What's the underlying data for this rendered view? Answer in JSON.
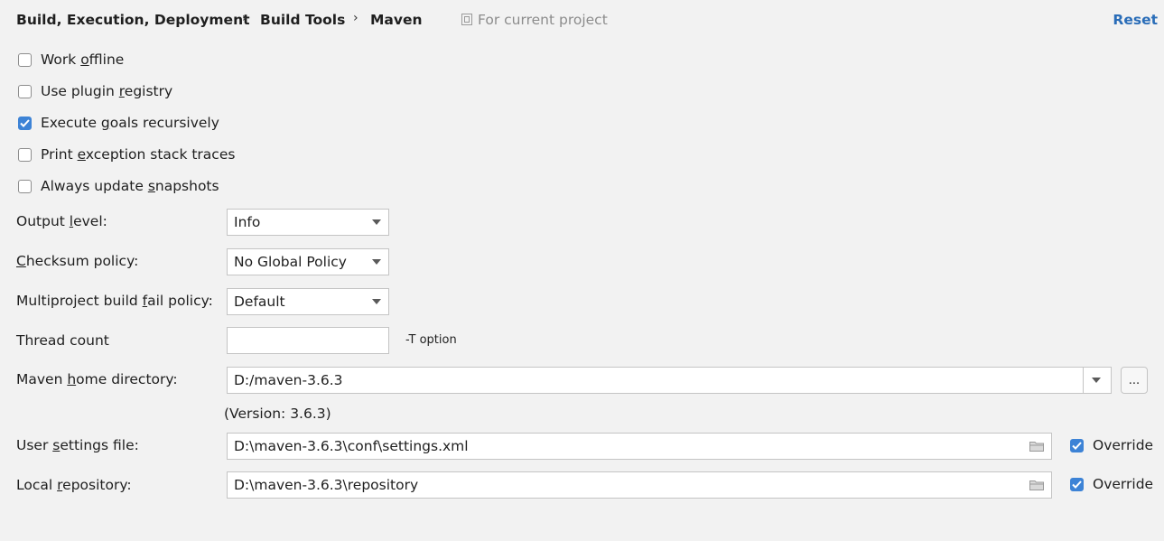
{
  "breadcrumb": {
    "items": [
      "Build, Execution, Deployment",
      "Build Tools",
      "Maven"
    ],
    "separator": "›",
    "scope_label": "For current project",
    "reset_label": "Reset"
  },
  "checkboxes": [
    {
      "pre": "Work ",
      "mnemonic": "o",
      "post": "ffline",
      "checked": false
    },
    {
      "pre": "Use plugin ",
      "mnemonic": "r",
      "post": "egistry",
      "checked": false
    },
    {
      "pre": "Execute ",
      "mnemonic": "g",
      "post": "oals recursively",
      "checked": true
    },
    {
      "pre": "Print ",
      "mnemonic": "e",
      "post": "xception stack traces",
      "checked": false
    },
    {
      "pre": "Always update ",
      "mnemonic": "s",
      "post": "napshots",
      "checked": false
    }
  ],
  "output_level": {
    "pre": "Output ",
    "mnemonic": "l",
    "post": "evel:",
    "value": "Info"
  },
  "checksum_policy": {
    "pre": "",
    "mnemonic": "C",
    "post": "hecksum policy:",
    "value": "No Global Policy"
  },
  "fail_policy": {
    "pre": "Multiproject build ",
    "mnemonic": "f",
    "post": "ail policy:",
    "value": "Default"
  },
  "thread_count": {
    "label": "Thread count",
    "value": "",
    "hint": "-T option"
  },
  "maven_home": {
    "pre": "Maven ",
    "mnemonic": "h",
    "post": "ome directory:",
    "value": "D:/maven-3.6.3",
    "browse_label": "...",
    "version": "(Version: 3.6.3)"
  },
  "user_settings": {
    "pre": "User ",
    "mnemonic": "s",
    "post": "ettings file:",
    "value": "D:\\maven-3.6.3\\conf\\settings.xml",
    "override_label": "Override",
    "override_checked": true
  },
  "local_repo": {
    "pre": "Local ",
    "mnemonic": "r",
    "post": "epository:",
    "value": "D:\\maven-3.6.3\\repository",
    "override_label": "Override",
    "override_checked": true
  },
  "colors": {
    "accent": "#3d83d6",
    "link": "#2a6db8",
    "background": "#f2f2f2"
  }
}
